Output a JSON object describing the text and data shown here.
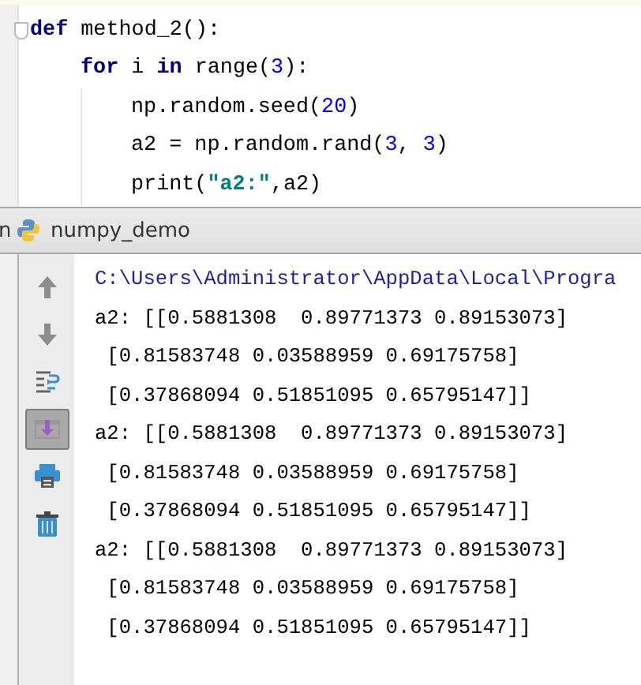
{
  "editor": {
    "lines": [
      {
        "tokens": [
          {
            "kind": "keyword",
            "text": "def"
          },
          {
            "kind": "plain",
            "text": " method_2():"
          }
        ],
        "fold": true,
        "children": [
          {
            "tokens": [
              {
                "kind": "keyword",
                "text": "for"
              },
              {
                "kind": "plain",
                "text": " i "
              },
              {
                "kind": "keyword",
                "text": "in"
              },
              {
                "kind": "plain",
                "text": " range("
              },
              {
                "kind": "number",
                "text": "3"
              },
              {
                "kind": "plain",
                "text": "):"
              }
            ],
            "children": [
              {
                "tokens": [
                  {
                    "kind": "plain",
                    "text": "np.random.seed("
                  },
                  {
                    "kind": "number",
                    "text": "20"
                  },
                  {
                    "kind": "plain",
                    "text": ")"
                  }
                ]
              },
              {
                "tokens": [
                  {
                    "kind": "plain",
                    "text": "a2 = np.random.rand("
                  },
                  {
                    "kind": "number",
                    "text": "3"
                  },
                  {
                    "kind": "plain",
                    "text": ", "
                  },
                  {
                    "kind": "number",
                    "text": "3"
                  },
                  {
                    "kind": "plain",
                    "text": ")"
                  }
                ]
              },
              {
                "tokens": [
                  {
                    "kind": "plain",
                    "text": "print("
                  },
                  {
                    "kind": "string",
                    "text": "\"a2:\""
                  },
                  {
                    "kind": "plain",
                    "text": ",a2)"
                  }
                ]
              }
            ]
          }
        ]
      }
    ]
  },
  "run_panel": {
    "cut_label": "n",
    "tab": "numpy_demo",
    "toolbar": [
      {
        "kind": "up",
        "selected": false
      },
      {
        "kind": "down",
        "selected": false
      },
      {
        "kind": "wrap",
        "selected": false
      },
      {
        "kind": "scroll-end",
        "selected": true
      },
      {
        "kind": "print",
        "selected": false
      },
      {
        "kind": "trash",
        "selected": false
      }
    ],
    "output": [
      {
        "kind": "command",
        "text": "C:\\Users\\Administrator\\AppData\\Local\\Progra"
      },
      {
        "kind": "out",
        "text": "a2: [[0.5881308  0.89771373 0.89153073]"
      },
      {
        "kind": "out",
        "text": " [0.81583748 0.03588959 0.69175758]"
      },
      {
        "kind": "out",
        "text": " [0.37868094 0.51851095 0.65795147]]"
      },
      {
        "kind": "out",
        "text": "a2: [[0.5881308  0.89771373 0.89153073]"
      },
      {
        "kind": "out",
        "text": " [0.81583748 0.03588959 0.69175758]"
      },
      {
        "kind": "out",
        "text": " [0.37868094 0.51851095 0.65795147]]"
      },
      {
        "kind": "out",
        "text": "a2: [[0.5881308  0.89771373 0.89153073]"
      },
      {
        "kind": "out",
        "text": " [0.81583748 0.03588959 0.69175758]"
      },
      {
        "kind": "out",
        "text": " [0.37868094 0.51851095 0.65795147]]"
      }
    ]
  }
}
